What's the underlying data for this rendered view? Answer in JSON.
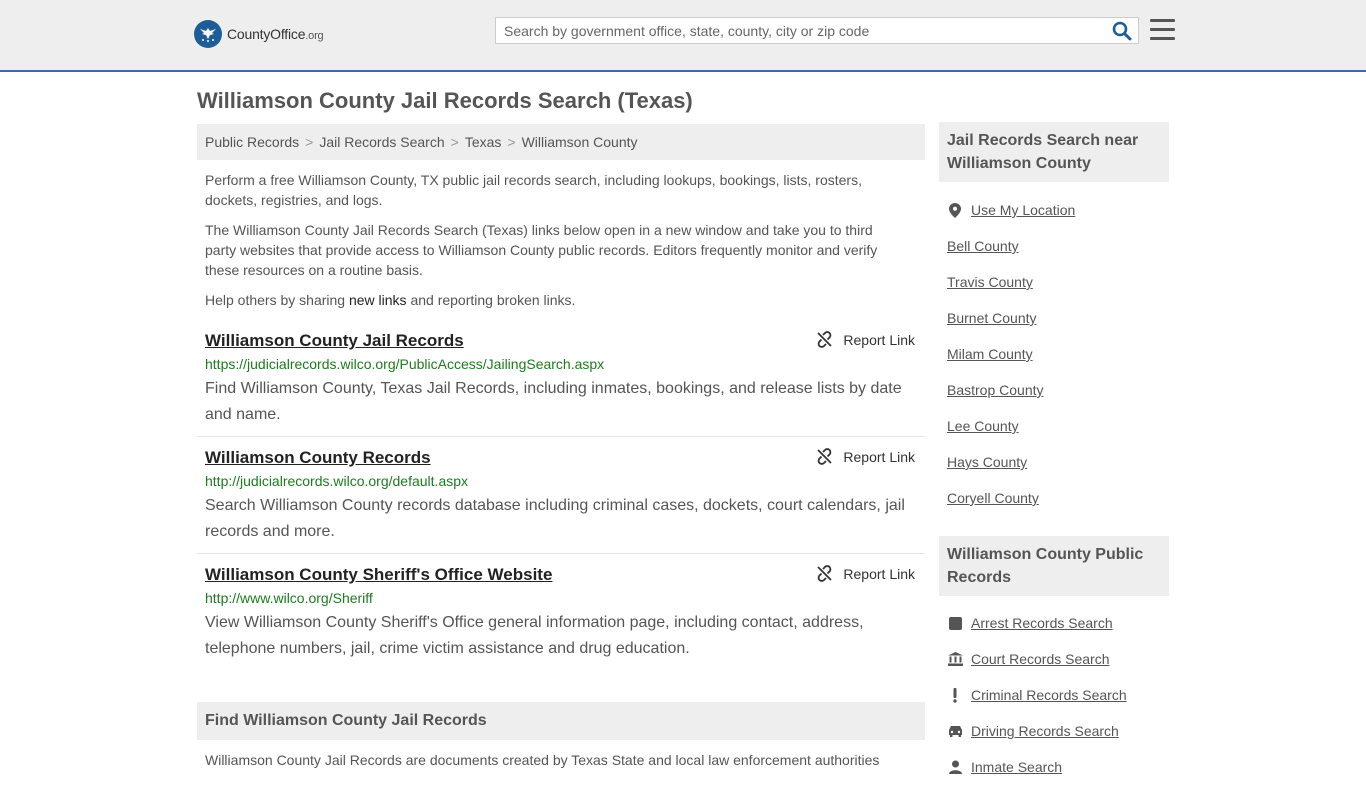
{
  "header": {
    "logo": {
      "county": "County",
      "office": "Office",
      "org": ".org"
    },
    "search": {
      "placeholder": "Search by government office, state, county, city or zip code"
    }
  },
  "page_title": "Williamson County Jail Records Search (Texas)",
  "breadcrumb": [
    "Public Records",
    "Jail Records Search",
    "Texas",
    "Williamson County"
  ],
  "intro": {
    "p1": "Perform a free Williamson County, TX public jail records search, including lookups, bookings, lists, rosters, dockets, registries, and logs.",
    "p2": "The Williamson County Jail Records Search (Texas) links below open in a new window and take you to third party websites that provide access to Williamson County public records. Editors frequently monitor and verify these resources on a routine basis.",
    "p3_before": "Help others by sharing ",
    "p3_link": "new links",
    "p3_after": " and reporting broken links."
  },
  "report_label": "Report Link",
  "results": [
    {
      "title": "Williamson County Jail Records",
      "url": "https://judicialrecords.wilco.org/PublicAccess/JailingSearch.aspx",
      "desc": "Find Williamson County, Texas Jail Records, including inmates, bookings, and release lists by date and name."
    },
    {
      "title": "Williamson County Records",
      "url": "http://judicialrecords.wilco.org/default.aspx",
      "desc": "Search Williamson County records database including criminal cases, dockets, court calendars, jail records and more."
    },
    {
      "title": "Williamson County Sheriff's Office Website",
      "url": "http://www.wilco.org/Sheriff",
      "desc": "View Williamson County Sheriff's Office general information page, including contact, address, telephone numbers, jail, crime victim assistance and drug education."
    }
  ],
  "find_section": {
    "title": "Find Williamson County Jail Records",
    "text": "Williamson County Jail Records are documents created by Texas State and local law enforcement authorities"
  },
  "sidebar": {
    "nearby_title": "Jail Records Search near Williamson County",
    "use_location": "Use My Location",
    "nearby": [
      "Bell County",
      "Travis County",
      "Burnet County",
      "Milam County",
      "Bastrop County",
      "Lee County",
      "Hays County",
      "Coryell County"
    ],
    "public_title": "Williamson County Public Records",
    "public_records": [
      "Arrest Records Search",
      "Court Records Search",
      "Criminal Records Search",
      "Driving Records Search",
      "Inmate Search"
    ]
  },
  "colors": {
    "accent": "#3b6aa6",
    "link_url": "#1e7b1e",
    "panel_bg": "#eeeeee",
    "text": "#555555"
  }
}
